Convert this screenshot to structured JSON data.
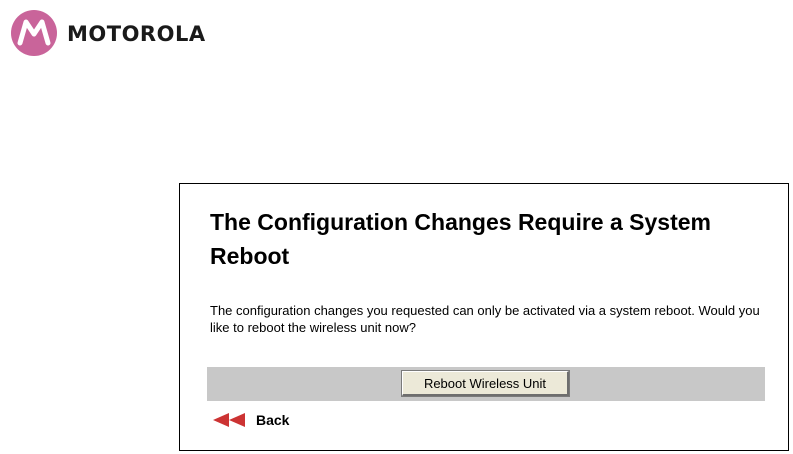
{
  "brand": {
    "wordmark": "MOTOROLA",
    "logo_icon": "motorola-batwing-logo",
    "logo_color": "#c9649a"
  },
  "panel": {
    "title": "The Configuration Changes Require a System Reboot",
    "message": "The configuration changes you requested can only be activated via a system reboot. Would you like to reboot the wireless unit now?",
    "reboot_button_label": "Reboot Wireless Unit",
    "back_label": "Back",
    "back_icon": "double-arrow-left-icon",
    "back_icon_color": "#cc3333",
    "action_bar_color": "#c8c8c8"
  }
}
